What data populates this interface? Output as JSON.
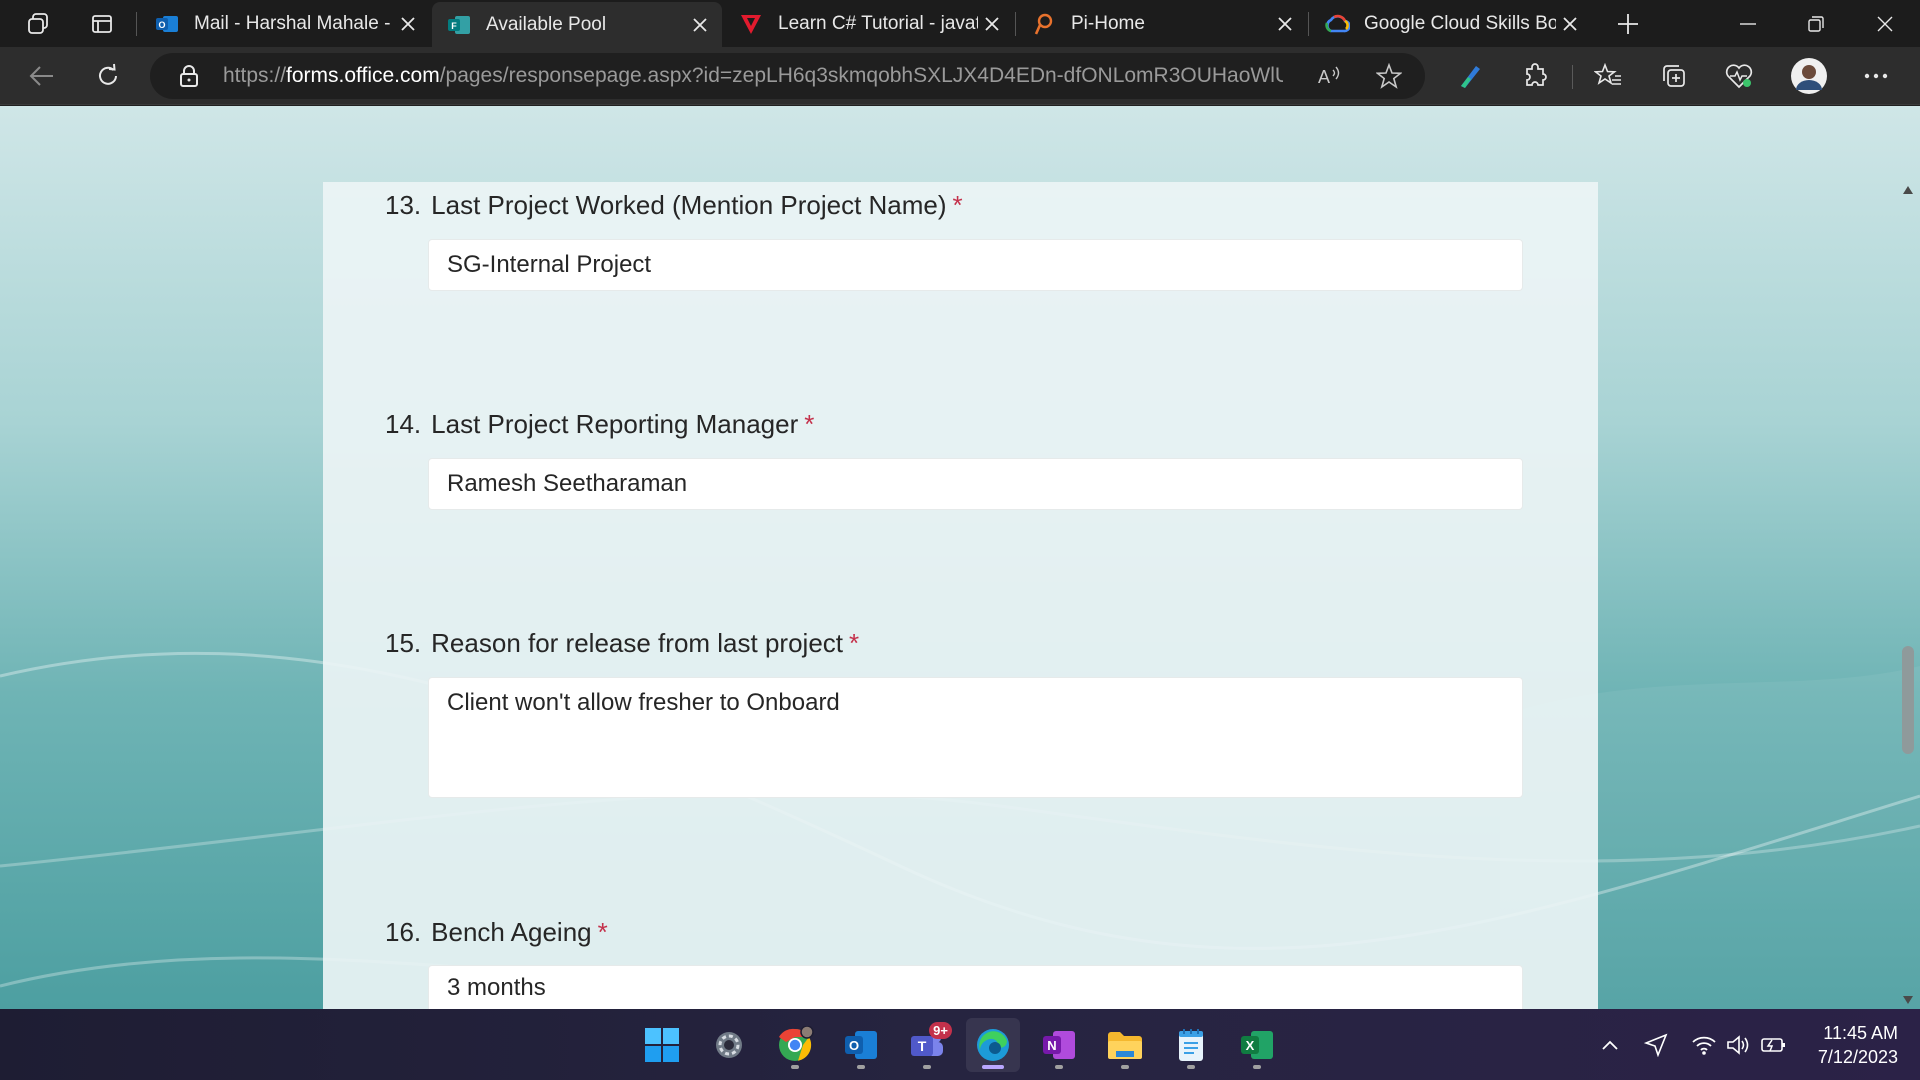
{
  "browser": {
    "tabs": [
      {
        "title": "Mail - Harshal Mahale - (",
        "icon": "outlook-icon",
        "active": false
      },
      {
        "title": "Available Pool",
        "icon": "forms-icon",
        "active": true
      },
      {
        "title": "Learn C# Tutorial - javatp",
        "icon": "javatpoint-icon",
        "active": false
      },
      {
        "title": "Pi-Home",
        "icon": "pi-icon",
        "active": false
      },
      {
        "title": "Google Cloud Skills Boos",
        "icon": "google-cloud-icon",
        "active": false
      }
    ],
    "address_bar": {
      "url_scheme": "https://",
      "url_host": "forms.office.com",
      "url_path": "/pages/responsepage.aspx?id=zepLH6q3skmqobhSXLJX4D4EDn-dfONLomR3OUHaoWlU..."
    }
  },
  "form": {
    "questions": [
      {
        "number": "13.",
        "label": "Last Project Worked (Mention Project Name)",
        "required_mark": "*",
        "answer": "SG-Internal Project"
      },
      {
        "number": "14.",
        "label": "Last Project Reporting Manager",
        "required_mark": "*",
        "answer": "Ramesh Seetharaman"
      },
      {
        "number": "15.",
        "label": "Reason for release from last project",
        "required_mark": "*",
        "answer": "Client won't allow fresher to Onboard"
      },
      {
        "number": "16.",
        "label": "Bench Ageing",
        "required_mark": "*",
        "answer": "3 months"
      }
    ]
  },
  "taskbar": {
    "apps": [
      "windows-start-icon",
      "settings-icon",
      "chrome-icon",
      "outlook-icon",
      "teams-icon",
      "edge-icon",
      "onenote-icon",
      "file-explorer-icon",
      "notepad-icon",
      "excel-icon"
    ],
    "teams_badge": "9+",
    "time": "11:45 AM",
    "date": "7/12/2023"
  },
  "colors": {
    "required": "#c4314b",
    "tab_active": "#2d2d2d",
    "tabstrip": "#1c1c1c",
    "page_gradient_top": "#cfe6e7",
    "page_gradient_bottom": "#4d9fa1"
  }
}
